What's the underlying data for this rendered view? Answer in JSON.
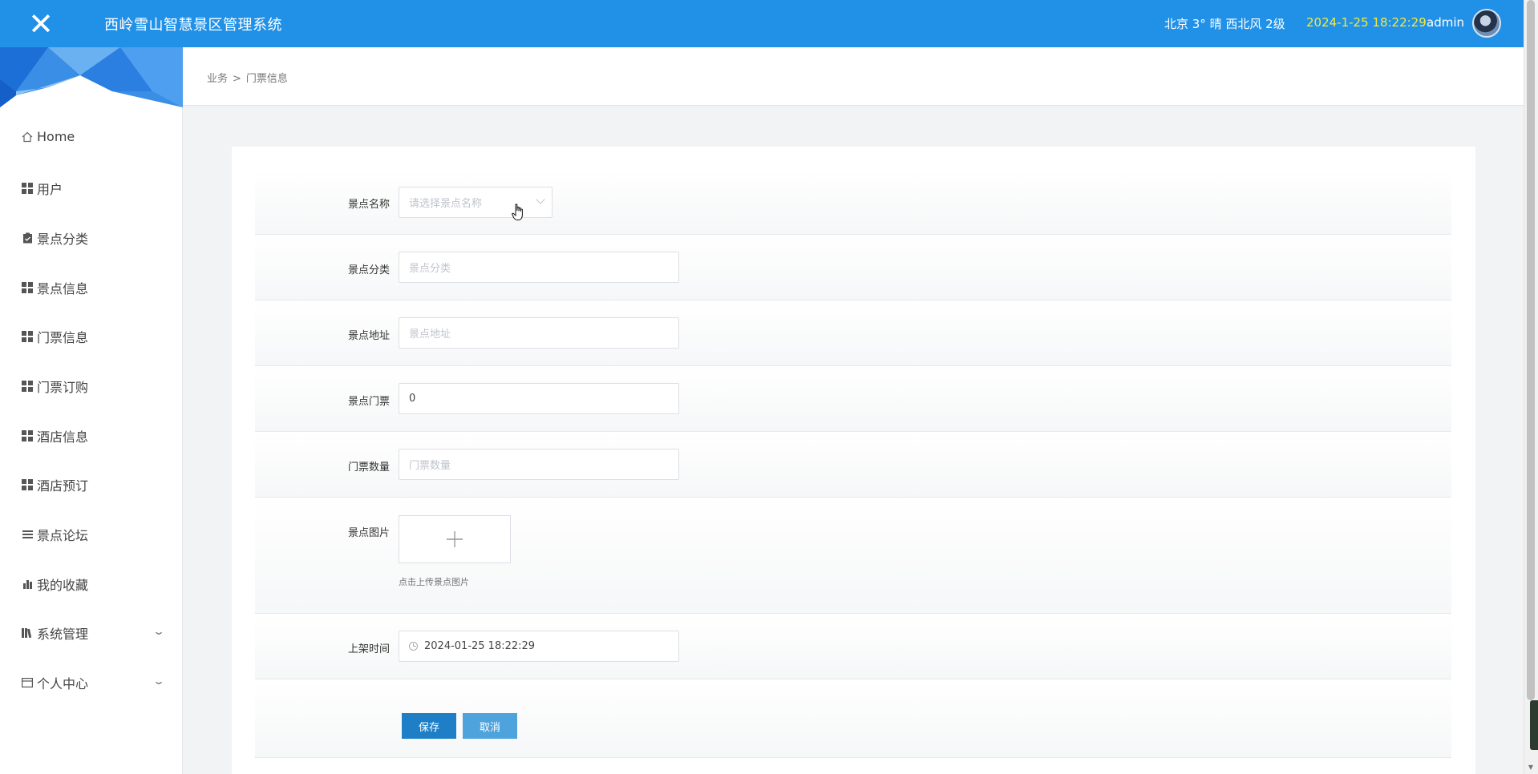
{
  "header": {
    "close_glyph": "✕",
    "app_title": "西岭雪山智慧景区管理系统",
    "weather": "北京  3°  晴  西北风  2级",
    "datetime": "2024-1-25 18:22:29",
    "username": "admin"
  },
  "sidebar": {
    "items": [
      {
        "label": "Home",
        "icon": "home-icon"
      },
      {
        "label": "用户",
        "icon": "grid-icon"
      },
      {
        "label": "景点分类",
        "icon": "clipboard-icon"
      },
      {
        "label": "景点信息",
        "icon": "grid-icon"
      },
      {
        "label": "门票信息",
        "icon": "grid-icon"
      },
      {
        "label": "门票订购",
        "icon": "grid-icon"
      },
      {
        "label": "酒店信息",
        "icon": "grid-icon"
      },
      {
        "label": "酒店预订",
        "icon": "grid-icon"
      },
      {
        "label": "景点论坛",
        "icon": "list-icon"
      },
      {
        "label": "我的收藏",
        "icon": "bar-chart-icon"
      },
      {
        "label": "系统管理",
        "icon": "library-icon"
      },
      {
        "label": "个人中心",
        "icon": "window-icon"
      }
    ]
  },
  "breadcrumb": {
    "parent": "业务",
    "separator": ">",
    "current": "门票信息"
  },
  "form": {
    "scenic_name": {
      "label": "景点名称",
      "placeholder": "请选择景点名称"
    },
    "scenic_category": {
      "label": "景点分类",
      "placeholder": "景点分类"
    },
    "scenic_address": {
      "label": "景点地址",
      "placeholder": "景点地址"
    },
    "ticket_price": {
      "label": "景点门票",
      "value": "0"
    },
    "ticket_quantity": {
      "label": "门票数量",
      "placeholder": "门票数量"
    },
    "scenic_image": {
      "label": "景点图片",
      "upload_tip": "点击上传景点图片"
    },
    "listing_time": {
      "label": "上架时间",
      "value": "2024-01-25 18:22:29"
    },
    "save_label": "保存",
    "cancel_label": "取消"
  },
  "colors": {
    "header_bg": "#2191e8",
    "datetime": "#f5e83a",
    "save_button": "#1f7fc6",
    "cancel_button": "#4fa3dd"
  }
}
